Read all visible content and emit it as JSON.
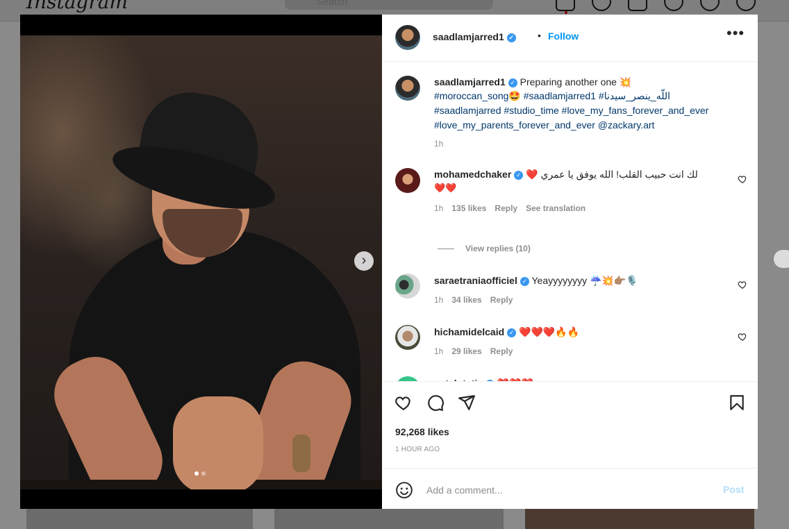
{
  "background": {
    "logo": "Instagram",
    "search_placeholder": "Search"
  },
  "post": {
    "username": "saadlamjarred1",
    "follow_label": "Follow",
    "bullet": "•",
    "more_label": "•••",
    "caption": {
      "username": "saadlamjarred1",
      "line1_text": "Preparing another one 💥",
      "line2_tags": "#moroccan_song🤩 #saadlamjarred1 #اللّه_ينصر_سيدنا",
      "line3_tags": "#saadlamjarred #studio_time #love_my_fans_forever_and_ever",
      "line4_tags": "#love_my_parents_forever_and_ever @zackary.art",
      "time": "1h"
    },
    "comments": [
      {
        "username": "mohamedchaker",
        "text_line1": "❤️ لك انت حبيب القلب! الله يوفق يا عمري",
        "text_line2": "❤️❤️",
        "time": "1h",
        "likes": "135 likes",
        "reply": "Reply",
        "translate": "See translation",
        "view_replies": "View replies (10)"
      },
      {
        "username": "saraetraniaofficiel",
        "text": "Yeayyyyyyyy ☔💥👉🏽🎙️",
        "time": "1h",
        "likes": "34 likes",
        "reply": "Reply"
      },
      {
        "username": "hichamidelcaid",
        "text": "❤️❤️❤️🔥🔥",
        "time": "1h",
        "likes": "29 likes",
        "reply": "Reply"
      },
      {
        "username": "nat_lutetia",
        "text": "❤️❤️❤️"
      }
    ],
    "likes_count": "92,268 likes",
    "time_ago": "1 HOUR AGO",
    "comment_placeholder": "Add a comment...",
    "post_label": "Post",
    "carousel": {
      "slide_count": 2,
      "active_index": 0
    }
  },
  "colors": {
    "link_blue": "#0095f6",
    "hashtag": "#00376b",
    "verified": "#3897f0",
    "secondary_text": "#8e8e8e"
  },
  "icons": [
    "verified-badge-icon",
    "more-options-icon",
    "next-arrow-icon",
    "heart-icon",
    "comment-icon",
    "share-icon",
    "bookmark-icon",
    "emoji-icon"
  ]
}
